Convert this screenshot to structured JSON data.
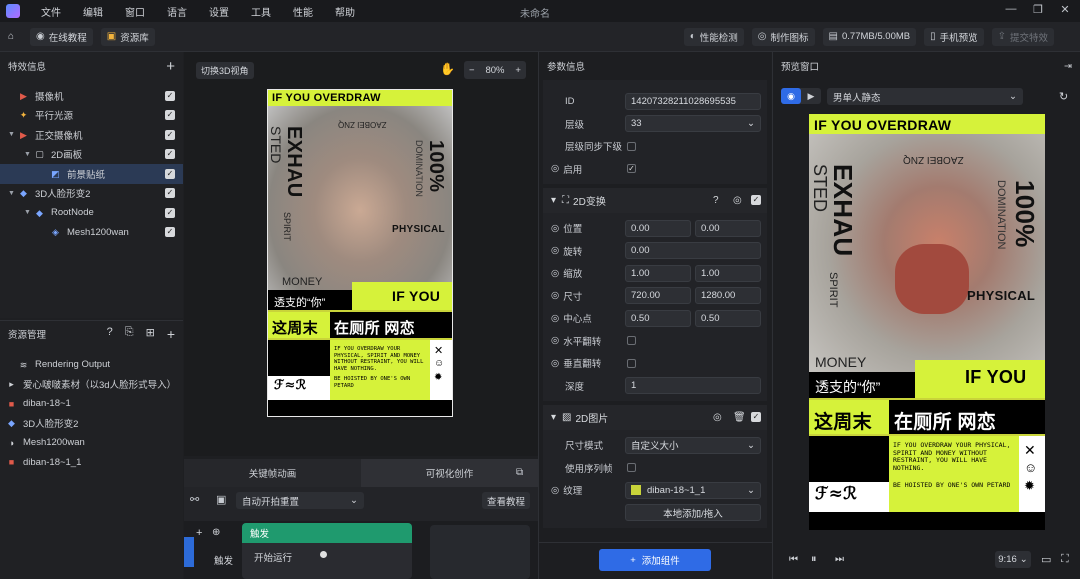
{
  "menu": [
    "文件",
    "编辑",
    "窗口",
    "语言",
    "设置",
    "工具",
    "性能",
    "帮助"
  ],
  "window_title": "未命名",
  "toolbar": {
    "online_tutorial": "在线教程",
    "asset_library": "资源库",
    "perf_check": "性能检测",
    "make_icon": "制作图标",
    "memory": "0.77MB/5.00MB",
    "phone_preview": "手机预览",
    "submit_effect": "提交特效"
  },
  "effects_panel": {
    "title": "特效信息",
    "items": [
      {
        "label": "摄像机",
        "depth": 0
      },
      {
        "label": "平行光源",
        "depth": 0
      },
      {
        "label": "正交摄像机",
        "depth": 0
      },
      {
        "label": "2D画板",
        "depth": 1
      },
      {
        "label": "前景贴纸",
        "depth": 2
      },
      {
        "label": "3D人脸形变2",
        "depth": 0
      },
      {
        "label": "RootNode",
        "depth": 1
      },
      {
        "label": "Mesh1200wan",
        "depth": 2
      }
    ]
  },
  "resources_panel": {
    "title": "资源管理",
    "items": [
      "Rendering Output",
      "爱心啵啵素材（以3d人脸形式导入）",
      "diban-18~1",
      "3D人脸形变2",
      "Mesh1200wan",
      "diban-18~1_1"
    ]
  },
  "canvas": {
    "toggle_3d": "切换3D视角",
    "zoom": "80%"
  },
  "poster": {
    "top_banner": "IF YOU OVERDRAW",
    "exhau": "EXHAU",
    "sted": "STED",
    "spirit": "SPIRIT",
    "hundred": "100%",
    "domination": "DOMINATION",
    "physical": "PHYSICAL",
    "zaobei": "ZAOBEI ZNQ",
    "money": "MONEY",
    "touzhi": "透支的“你”",
    "if_you": "IF YOU",
    "weekend": "这周末",
    "toilet": "在厕所 网恋",
    "body_text": "IF YOU OVERDRAW YOUR PHYSICAL, SPIRIT AND MONEY WITHOUT RESTRAINT, YOU WILL HAVE NOTHING.",
    "hoisted": "BE HOISTED BY ONE'S OWN PETARD"
  },
  "bottom_tabs": {
    "keyframe": "关键帧动画",
    "visual": "可视化创作",
    "auto_start": "自动开拍重置",
    "view_tutorial": "查看教程",
    "node_title": "触发",
    "start_run": "开始运行",
    "trigger": "触发"
  },
  "params": {
    "title": "参数信息",
    "id_label": "ID",
    "id_value": "14207328211028695535",
    "layer_label": "层级",
    "layer_value": "33",
    "layer_sync": "层级同步下级",
    "enable": "启用",
    "section_2d": "2D变换",
    "position": "位置",
    "pos_x": "0.00",
    "pos_y": "0.00",
    "rotation": "旋转",
    "rot_value": "0.00",
    "scale": "缩放",
    "scale_x": "1.00",
    "scale_y": "1.00",
    "size": "尺寸",
    "size_w": "720.00",
    "size_h": "1280.00",
    "center": "中心点",
    "center_x": "0.50",
    "center_y": "0.50",
    "flip_h": "水平翻转",
    "flip_v": "垂直翻转",
    "depth": "深度",
    "depth_value": "1",
    "section_img": "2D图片",
    "size_mode": "尺寸模式",
    "size_mode_value": "自定义大小",
    "use_sequence": "使用序列帧",
    "texture": "纹理",
    "texture_value": "diban-18~1_1",
    "local_add": "本地添加/拖入",
    "add_component": "添加组件"
  },
  "preview": {
    "title": "预览窗口",
    "model": "男单人静态",
    "ratio": "9:16"
  }
}
